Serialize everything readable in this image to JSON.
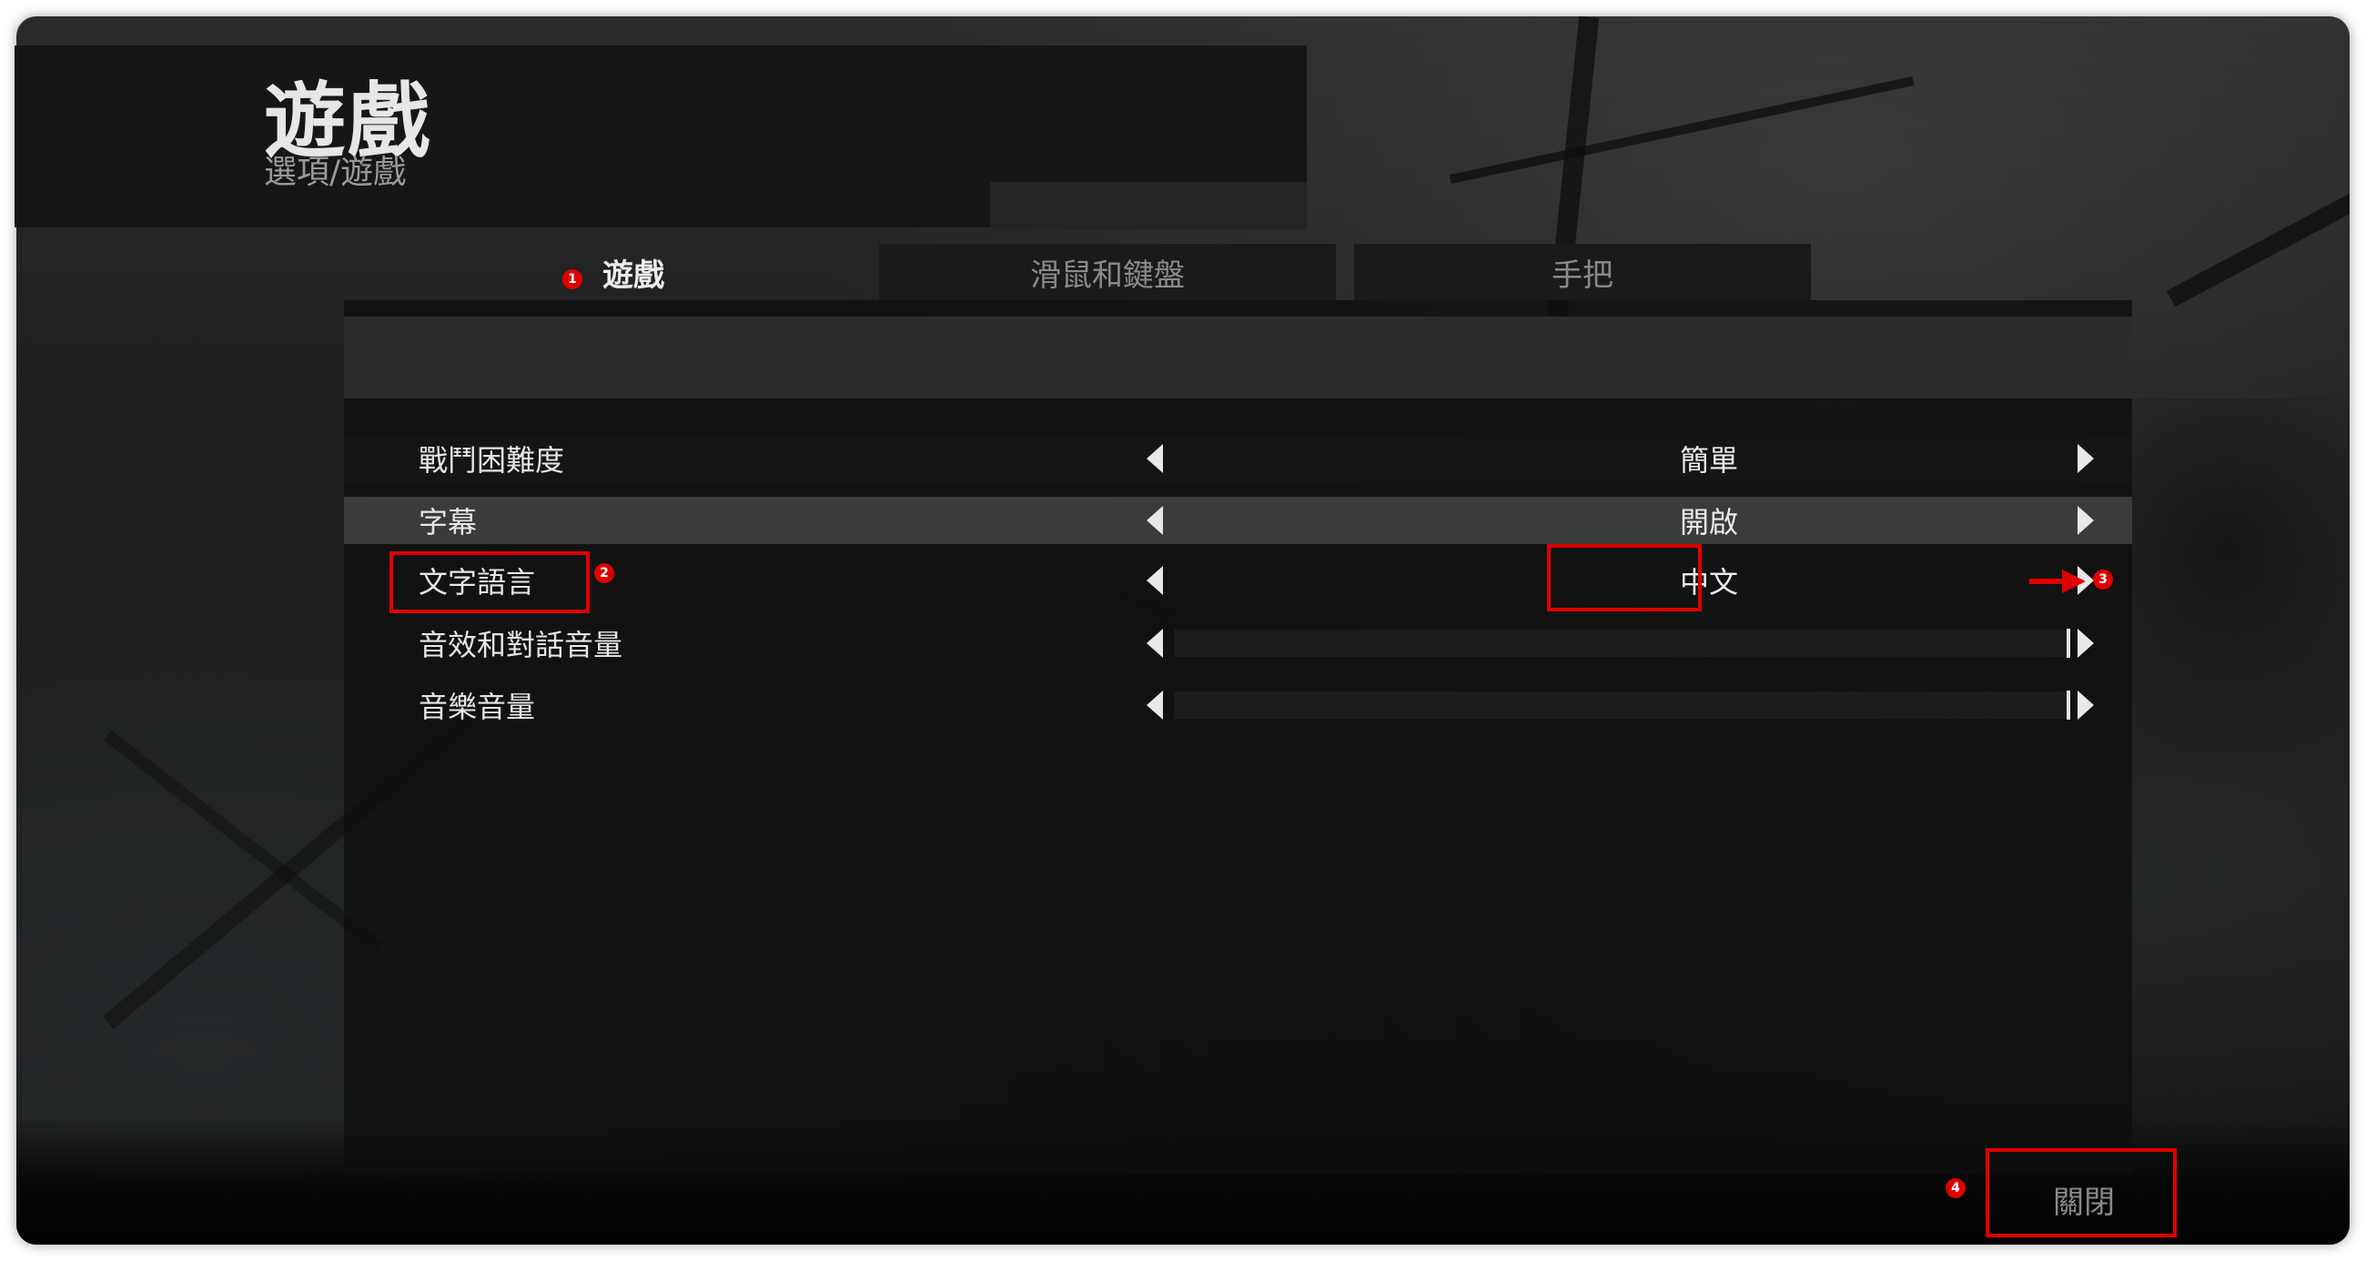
{
  "header": {
    "title": "遊戲",
    "breadcrumb": "選項/遊戲"
  },
  "tabs": [
    {
      "label": "遊戲",
      "active": true
    },
    {
      "label": "滑鼠和鍵盤",
      "active": false
    },
    {
      "label": "手把",
      "active": false
    }
  ],
  "settings": [
    {
      "label": "戰鬥困難度",
      "value": "簡單"
    },
    {
      "label": "字幕",
      "value": "開啟"
    },
    {
      "label": "文字語言",
      "value": "中文"
    },
    {
      "label": "音效和對話音量",
      "value": 1.0
    },
    {
      "label": "音樂音量",
      "value": 1.0
    }
  ],
  "close_label": "關閉",
  "annotations": [
    "1",
    "2",
    "3",
    "4"
  ],
  "colors": {
    "annotation": "#e00000",
    "text_primary": "#e6e6e6",
    "text_muted": "#8a8a8a",
    "highlight_row": "#3a3b3c"
  }
}
